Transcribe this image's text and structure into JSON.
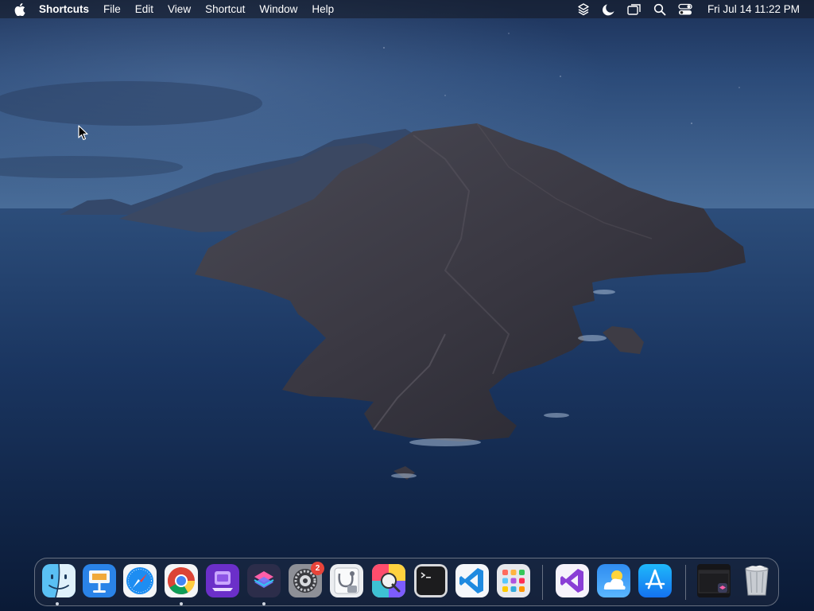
{
  "menubar": {
    "app_name": "Shortcuts",
    "menus": [
      "File",
      "Edit",
      "View",
      "Shortcut",
      "Window",
      "Help"
    ],
    "status_icons": [
      "layers-icon",
      "moon-icon",
      "screen-mirroring-icon",
      "spotlight-search-icon",
      "control-center-icon"
    ],
    "clock": "Fri Jul 14  11:22 PM"
  },
  "dock": {
    "apps": [
      {
        "name": "Finder",
        "icon": "finder-icon",
        "running": true
      },
      {
        "name": "Keynote",
        "icon": "keynote-icon",
        "running": false
      },
      {
        "name": "Safari",
        "icon": "safari-icon",
        "running": false
      },
      {
        "name": "Google Chrome",
        "icon": "chrome-icon",
        "running": true
      },
      {
        "name": "Apple Configurator",
        "icon": "configurator-icon",
        "running": false
      },
      {
        "name": "Shortcuts",
        "icon": "shortcuts-icon",
        "running": true
      },
      {
        "name": "System Settings",
        "icon": "settings-icon",
        "running": false,
        "badge": "2"
      },
      {
        "name": "Disk Utility",
        "icon": "disk-utility-icon",
        "running": false
      },
      {
        "name": "ColorSync Utility",
        "icon": "colorsync-icon",
        "running": false
      },
      {
        "name": "Terminal",
        "icon": "terminal-icon",
        "running": false
      },
      {
        "name": "Visual Studio Code",
        "icon": "vscode-icon",
        "running": false
      },
      {
        "name": "Launchpad",
        "icon": "launchpad-icon",
        "running": false
      },
      {
        "name": "Visual Studio",
        "icon": "visual-studio-icon",
        "running": false
      },
      {
        "name": "Weather",
        "icon": "weather-icon",
        "running": false
      },
      {
        "name": "App Store",
        "icon": "app-store-icon",
        "running": false
      },
      {
        "name": "Recent Window",
        "icon": "minimized-window-icon",
        "running": false
      },
      {
        "name": "Trash",
        "icon": "trash-icon",
        "running": false
      }
    ]
  }
}
